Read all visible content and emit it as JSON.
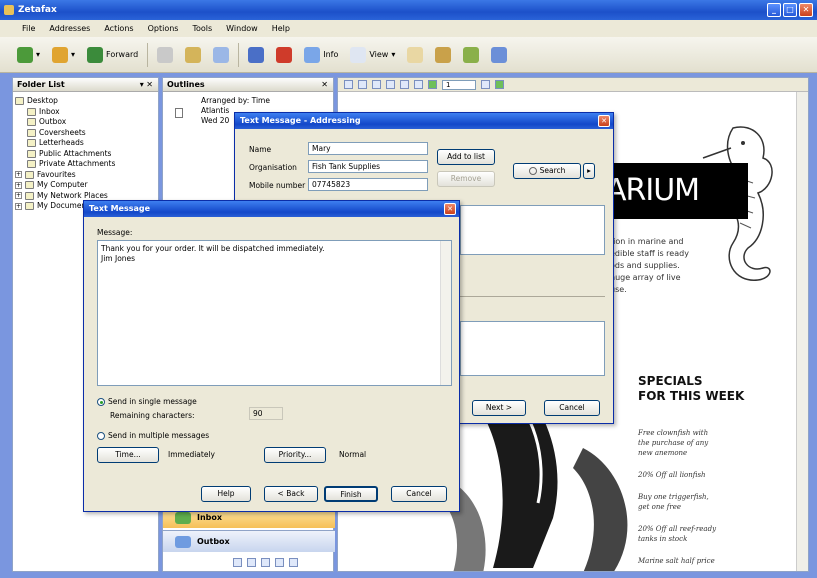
{
  "window": {
    "title": "Zetafax"
  },
  "menu": [
    "File",
    "Addresses",
    "Actions",
    "Options",
    "Tools",
    "Window",
    "Help"
  ],
  "toolbar": {
    "forward": "Forward",
    "info": "Info",
    "view": "View"
  },
  "folder_pane": {
    "title": "Folder List",
    "controls": "▾ ✕",
    "items": [
      {
        "label": "Desktop",
        "indent": 0,
        "exp": ""
      },
      {
        "label": "Inbox",
        "indent": 1,
        "exp": ""
      },
      {
        "label": "Outbox",
        "indent": 1,
        "exp": ""
      },
      {
        "label": "Coversheets",
        "indent": 1,
        "exp": ""
      },
      {
        "label": "Letterheads",
        "indent": 1,
        "exp": ""
      },
      {
        "label": "Public Attachments",
        "indent": 1,
        "exp": ""
      },
      {
        "label": "Private Attachments",
        "indent": 1,
        "exp": ""
      },
      {
        "label": "Favourites",
        "indent": 0,
        "exp": "+"
      },
      {
        "label": "My Computer",
        "indent": 0,
        "exp": "+"
      },
      {
        "label": "My Network Places",
        "indent": 0,
        "exp": "+"
      },
      {
        "label": "My Documents",
        "indent": 0,
        "exp": "+"
      }
    ]
  },
  "outline_pane": {
    "title": "Outlines",
    "close": "✕",
    "arranged_by": "Arranged by: Time",
    "lines": [
      "Atlantis",
      "Wed 20"
    ],
    "bars": [
      {
        "label": "Inbox"
      },
      {
        "label": "Outbox"
      }
    ]
  },
  "doc": {
    "page_field": "1",
    "headline": "ARIUM",
    "body": "tion in marine and\nedible staff is ready\nods and supplies.\nhuge array of live\nuse.",
    "specials_title": "SPECIALS\nFOR THIS WEEK",
    "specials": [
      "Free clownfish with\nthe purchase of any\nnew anemone",
      "20% Off all lionfish",
      "Buy one triggerfish,\nget one free",
      "20% Off all reef-ready\ntanks in stock",
      "Marine salt half price"
    ]
  },
  "addressing_dialog": {
    "title": "Text Message - Addressing",
    "name_label": "Name",
    "name_value": "Mary",
    "org_label": "Organisation",
    "org_value": "Fish Tank Supplies",
    "mobile_label": "Mobile number",
    "mobile_value": "07745823",
    "add_to_list": "Add to list",
    "remove": "Remove",
    "search": "Search",
    "next": "Next >",
    "cancel": "Cancel"
  },
  "text_dialog": {
    "title": "Text Message",
    "message_label": "Message:",
    "message_text": "Thank you for your order. It will be dispatched immediately.\nJim Jones",
    "single_label": "Send in single message",
    "remaining_label": "Remaining characters:",
    "remaining_value": "90",
    "multiple_label": "Send in multiple messages",
    "time_btn": "Time...",
    "time_value": "Immediately",
    "priority_btn": "Priority...",
    "priority_value": "Normal",
    "help": "Help",
    "back": "< Back",
    "finish": "Finish",
    "cancel": "Cancel"
  },
  "colors": {
    "titlebar": "#1c50c9",
    "desktop": "#7a96df",
    "outline_bar": "#f6c057"
  }
}
